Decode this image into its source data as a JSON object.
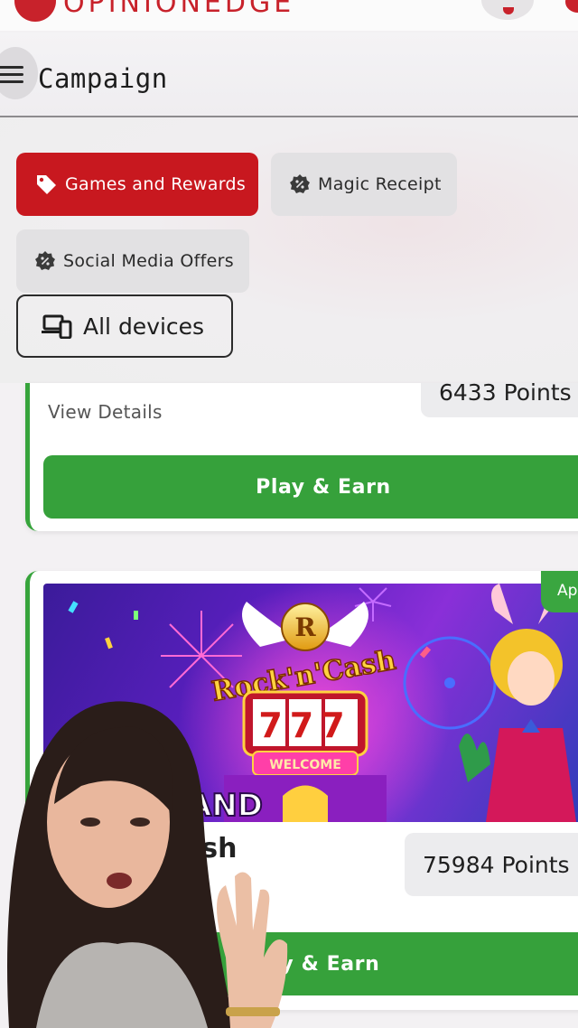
{
  "brand": {
    "name": "OPINIONEDGE",
    "accent_color": "#c8222b"
  },
  "header": {
    "menu_icon": "hamburger-menu-icon",
    "title": "Campaign"
  },
  "filters": {
    "chips": [
      {
        "label": "Games and Rewards",
        "icon": "price-tag-icon",
        "active": true
      },
      {
        "label": "Magic Receipt",
        "icon": "percent-badge-icon",
        "active": false
      },
      {
        "label": "Social Media Offers",
        "icon": "percent-badge-icon",
        "active": false
      }
    ],
    "devices_button": {
      "label": "All devices",
      "icon": "devices-icon"
    }
  },
  "offers": [
    {
      "points": "6433 Points",
      "details_link": "View Details",
      "cta": "Play & Earn",
      "cta_color": "#36a13b"
    },
    {
      "badge": "Ap",
      "banner_texts": {
        "logo_letter": "R",
        "game_logo": "Rock'n'Cash",
        "reels": "777",
        "sign": "WELCOME",
        "tagline": "AND"
      },
      "title": "Cash",
      "points": "75984 Points",
      "cta": "ay & Earn",
      "cta_color": "#36a13b"
    }
  ]
}
